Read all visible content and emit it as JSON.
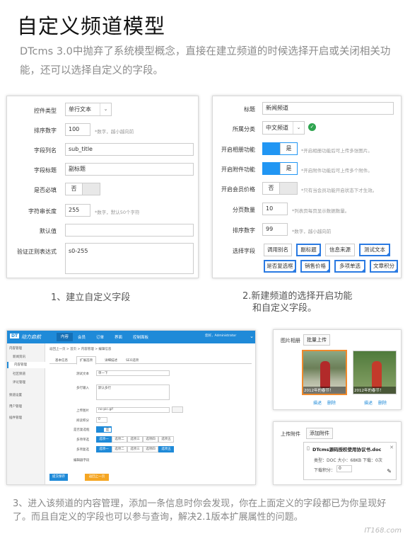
{
  "header": {
    "title": "自定义频道模型",
    "intro": "DTcms 3.0中抛弃了系统模型概念，直接在建立频道的时候选择开启或关闭相关功能，还可以选择自定义的字段。"
  },
  "field_form": {
    "rows": [
      {
        "label": "控件类型",
        "value": "单行文本"
      },
      {
        "label": "排序数字",
        "value": "100",
        "hint": "*数字，越小越向前"
      },
      {
        "label": "字段列名",
        "value": "sub_title"
      },
      {
        "label": "字段标题",
        "value": "副标题"
      },
      {
        "label": "是否必填",
        "value": "否"
      },
      {
        "label": "字符串长度",
        "value": "255",
        "hint": "*数字，默认50个字符"
      },
      {
        "label": "默认值",
        "value": ""
      },
      {
        "label": "验证正则表达式",
        "value": "s0-255"
      }
    ],
    "caption": "1、建立自定义字段"
  },
  "channel_form": {
    "rows": [
      {
        "label": "标题",
        "value": "新闻频道"
      },
      {
        "label": "所属分类",
        "value": "中文频道"
      },
      {
        "label": "开启相册功能",
        "value": "是",
        "hint": "*开启相册功能后可上传多张图片。"
      },
      {
        "label": "开启附件功能",
        "value": "是",
        "hint": "*开启附件功能后可上传多个附件。"
      },
      {
        "label": "开启会员价格",
        "value": "否",
        "hint": "*只有当会员功能开启状态下才生效。"
      },
      {
        "label": "分页数量",
        "value": "10",
        "hint": "*列表页每页显示数据数量。"
      },
      {
        "label": "排序数字",
        "value": "99",
        "hint": "*数字，越小越向前"
      },
      {
        "label": "选择字段",
        "value": ""
      }
    ],
    "fields": [
      {
        "label": "调用别名",
        "active": false
      },
      {
        "label": "副标题",
        "active": true
      },
      {
        "label": "信息来源",
        "active": false
      },
      {
        "label": "测试文本",
        "active": true
      },
      {
        "label": "是否复选框",
        "active": true
      },
      {
        "label": "销售价格",
        "active": true
      },
      {
        "label": "多项单选",
        "active": true
      },
      {
        "label": "文章积分",
        "active": true
      }
    ],
    "caption_line1": "2.新建频道的选择开启功能",
    "caption_line2": "和自定义字段。"
  },
  "cms": {
    "logo": "DT",
    "brand": "动力启航",
    "nav": [
      "内容",
      "会员",
      "订单",
      "界面",
      "控制面板"
    ],
    "user": "您好，Administrator",
    "sidebar": [
      "内容管理",
      "新闻资讯",
      "内容管理",
      "社区频道",
      "评论管理",
      "频道设置",
      "用户管理",
      "插件管理"
    ],
    "breadcrumb": "返回上一页 > 首页 > 内容管理 > 编辑信息",
    "tabs": [
      "基本信息",
      "扩展选项",
      "详细描述",
      "SEO选项"
    ],
    "form_rows": [
      {
        "label": "测试文本",
        "value": "单一下"
      },
      {
        "label": "多行输入",
        "value": "默认多行"
      },
      {
        "label": "上传图片",
        "value": "no-pic.gif"
      },
      {
        "label": "阅读积分",
        "value": "0"
      },
      {
        "label": "是否复选框",
        "value": "是"
      },
      {
        "label": "多项单选",
        "value": "选项一"
      },
      {
        "label": "多项复选",
        "value": "选项一"
      },
      {
        "label": "编辑器字段",
        "value": ""
      }
    ],
    "options": [
      "选项一",
      "选项二",
      "选项三",
      "选项四",
      "选项五"
    ],
    "submit": "提交保存",
    "back": "返回上一页"
  },
  "album": {
    "tabs": [
      "图片相册",
      "批量上传"
    ],
    "photos": [
      {
        "date": "2012年的春节！",
        "actions": [
          "描述",
          "删除"
        ]
      },
      {
        "date": "2012年的春节！",
        "actions": [
          "描述",
          "删除"
        ]
      }
    ]
  },
  "attach": {
    "label": "上传附件",
    "button": "添加附件",
    "filename": "DTcms源码授权使用协议书.doc",
    "info": "类型：DOC 大小：68KB 下载：0次",
    "points_label": "下载积分：",
    "points_value": "0"
  },
  "footer": {
    "text": "3、进入该频道的内容管理，添加一条信息时你会发现，你在上面定义的字段都已为你呈现好了。而且自定义的字段也可以参与查询，解决2.1版本扩展属性的问题。",
    "watermark": "IT168.com"
  },
  "colors": {
    "accent": "#2a7ae2",
    "nav": "#1f8ad8",
    "green": "#2ea44f"
  }
}
